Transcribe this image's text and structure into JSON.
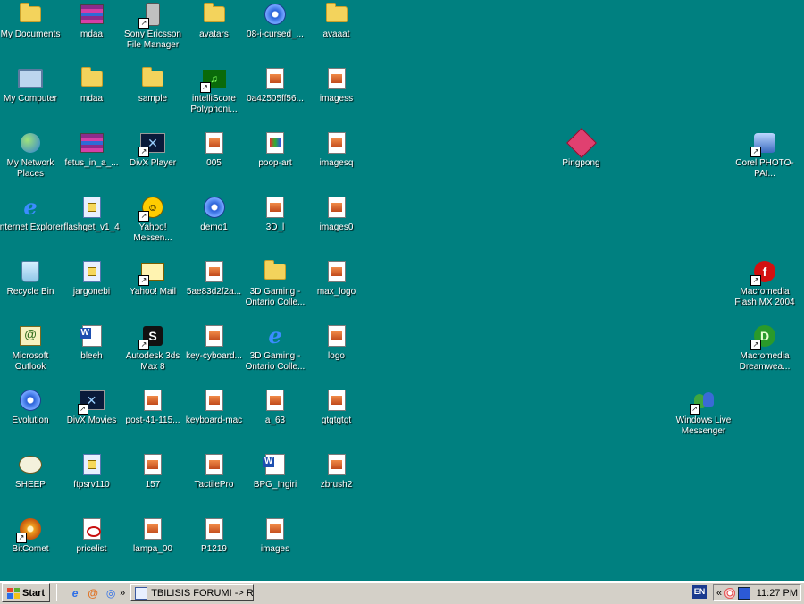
{
  "desktop": {
    "icons": [
      {
        "id": "my-documents",
        "label": "My Documents",
        "glyph": "g-folder",
        "col": 0,
        "row": 0,
        "shortcut": false
      },
      {
        "id": "my-computer",
        "label": "My Computer",
        "glyph": "g-pc",
        "col": 0,
        "row": 1,
        "shortcut": false
      },
      {
        "id": "my-network-places",
        "label": "My Network Places",
        "glyph": "g-globe",
        "col": 0,
        "row": 2,
        "shortcut": false
      },
      {
        "id": "internet-explorer",
        "label": "Internet Explorer",
        "glyph": "g-ie",
        "col": 0,
        "row": 3,
        "shortcut": false
      },
      {
        "id": "recycle-bin",
        "label": "Recycle Bin",
        "glyph": "g-bin",
        "col": 0,
        "row": 4,
        "shortcut": false
      },
      {
        "id": "microsoft-outlook",
        "label": "Microsoft Outlook",
        "glyph": "g-outlook",
        "col": 0,
        "row": 5,
        "shortcut": false
      },
      {
        "id": "evolution",
        "label": "Evolution",
        "glyph": "g-media",
        "col": 0,
        "row": 6,
        "shortcut": false
      },
      {
        "id": "sheep",
        "label": "SHEEP",
        "glyph": "g-sheep",
        "col": 0,
        "row": 7,
        "shortcut": false
      },
      {
        "id": "bitcomet",
        "label": "BitComet",
        "glyph": "g-bitcomet",
        "col": 0,
        "row": 8,
        "shortcut": true
      },
      {
        "id": "mdaa-rar",
        "label": "mdaa",
        "glyph": "g-rar",
        "col": 1,
        "row": 0,
        "shortcut": false
      },
      {
        "id": "mdaa-folder",
        "label": "mdaa",
        "glyph": "g-folder",
        "col": 1,
        "row": 1,
        "shortcut": false
      },
      {
        "id": "fetus",
        "label": "fetus_in_a_...",
        "glyph": "g-rar",
        "col": 1,
        "row": 2,
        "shortcut": false
      },
      {
        "id": "flashget",
        "label": "flashget_v1_4",
        "glyph": "g-exe",
        "col": 1,
        "row": 3,
        "shortcut": false
      },
      {
        "id": "jargonebi",
        "label": "jargonebi",
        "glyph": "g-exe",
        "col": 1,
        "row": 4,
        "shortcut": false
      },
      {
        "id": "bleeh",
        "label": "bleeh",
        "glyph": "g-word",
        "col": 1,
        "row": 5,
        "shortcut": false
      },
      {
        "id": "divx-movies",
        "label": "DivX Movies",
        "glyph": "g-divx",
        "col": 1,
        "row": 6,
        "shortcut": true
      },
      {
        "id": "ftpsrv110",
        "label": "ftpsrv110",
        "glyph": "g-exe",
        "col": 1,
        "row": 7,
        "shortcut": false
      },
      {
        "id": "pricelist",
        "label": "pricelist",
        "glyph": "g-pdf",
        "col": 1,
        "row": 8,
        "shortcut": false
      },
      {
        "id": "sony-ericsson",
        "label": "Sony Ericsson File Manager",
        "glyph": "g-ericsson",
        "col": 2,
        "row": 0,
        "shortcut": true
      },
      {
        "id": "sample",
        "label": "sample",
        "glyph": "g-folder",
        "col": 2,
        "row": 1,
        "shortcut": false
      },
      {
        "id": "divx-player",
        "label": "DivX Player",
        "glyph": "g-divx",
        "col": 2,
        "row": 2,
        "shortcut": true
      },
      {
        "id": "yahoo-messenger",
        "label": "Yahoo! Messen...",
        "glyph": "g-yahoo",
        "col": 2,
        "row": 3,
        "shortcut": true
      },
      {
        "id": "yahoo-mail",
        "label": "Yahoo! Mail",
        "glyph": "g-ymail",
        "col": 2,
        "row": 4,
        "shortcut": true
      },
      {
        "id": "autodesk-3ds",
        "label": "Autodesk 3ds Max 8",
        "glyph": "g-3ds",
        "col": 2,
        "row": 5,
        "shortcut": true
      },
      {
        "id": "post-41",
        "label": "post-41-115...",
        "glyph": "g-img",
        "col": 2,
        "row": 6,
        "shortcut": false
      },
      {
        "id": "img-157",
        "label": "157",
        "glyph": "g-img",
        "col": 2,
        "row": 7,
        "shortcut": false
      },
      {
        "id": "lampa",
        "label": "lampa_00",
        "glyph": "g-img",
        "col": 2,
        "row": 8,
        "shortcut": false
      },
      {
        "id": "avatars",
        "label": "avatars",
        "glyph": "g-folder",
        "col": 3,
        "row": 0,
        "shortcut": false
      },
      {
        "id": "intelliscore",
        "label": "intelliScore Polyphoni...",
        "glyph": "g-intelli",
        "col": 3,
        "row": 1,
        "shortcut": true
      },
      {
        "id": "img-005",
        "label": "005",
        "glyph": "g-img",
        "col": 3,
        "row": 2,
        "shortcut": false
      },
      {
        "id": "demo1",
        "label": "demo1",
        "glyph": "g-media",
        "col": 3,
        "row": 3,
        "shortcut": false
      },
      {
        "id": "img-5ae83",
        "label": "5ae83d2f2a...",
        "glyph": "g-img",
        "col": 3,
        "row": 4,
        "shortcut": false
      },
      {
        "id": "key-cyboard",
        "label": "key-cyboard...",
        "glyph": "g-img",
        "col": 3,
        "row": 5,
        "shortcut": false
      },
      {
        "id": "keyboard-mac",
        "label": "keyboard-mac",
        "glyph": "g-img",
        "col": 3,
        "row": 6,
        "shortcut": false
      },
      {
        "id": "tactilepro",
        "label": "TactilePro",
        "glyph": "g-img",
        "col": 3,
        "row": 7,
        "shortcut": false
      },
      {
        "id": "p1219",
        "label": "P1219",
        "glyph": "g-img",
        "col": 3,
        "row": 8,
        "shortcut": false
      },
      {
        "id": "cursed",
        "label": "08-i-cursed_...",
        "glyph": "g-media",
        "col": 4,
        "row": 0,
        "shortcut": false
      },
      {
        "id": "img-0a425",
        "label": "0a42505ff56...",
        "glyph": "g-img",
        "col": 4,
        "row": 1,
        "shortcut": false
      },
      {
        "id": "poop-art",
        "label": "poop-art",
        "glyph": "g-poop",
        "col": 4,
        "row": 2,
        "shortcut": false
      },
      {
        "id": "img-3d-l",
        "label": "3D_l",
        "glyph": "g-img",
        "col": 4,
        "row": 3,
        "shortcut": false
      },
      {
        "id": "gaming-folder",
        "label": "3D Gaming - Ontario Colle...",
        "glyph": "g-folder",
        "col": 4,
        "row": 4,
        "shortcut": false
      },
      {
        "id": "gaming-ie",
        "label": "3D Gaming - Ontario Colle...",
        "glyph": "g-ie",
        "col": 4,
        "row": 5,
        "shortcut": false
      },
      {
        "id": "a63",
        "label": "a_63",
        "glyph": "g-img",
        "col": 4,
        "row": 6,
        "shortcut": false
      },
      {
        "id": "bpg-ingiri",
        "label": "BPG_Ingiri",
        "glyph": "g-word",
        "col": 4,
        "row": 7,
        "shortcut": false
      },
      {
        "id": "images",
        "label": "images",
        "glyph": "g-img",
        "col": 4,
        "row": 8,
        "shortcut": false
      },
      {
        "id": "avaaat",
        "label": "avaaat",
        "glyph": "g-folder",
        "col": 5,
        "row": 0,
        "shortcut": false
      },
      {
        "id": "imagess",
        "label": "imagess",
        "glyph": "g-img",
        "col": 5,
        "row": 1,
        "shortcut": false
      },
      {
        "id": "imagesq",
        "label": "imagesq",
        "glyph": "g-img",
        "col": 5,
        "row": 2,
        "shortcut": false
      },
      {
        "id": "images0",
        "label": "images0",
        "glyph": "g-img",
        "col": 5,
        "row": 3,
        "shortcut": false
      },
      {
        "id": "max-logo",
        "label": "max_logo",
        "glyph": "g-img",
        "col": 5,
        "row": 4,
        "shortcut": false
      },
      {
        "id": "logo",
        "label": "logo",
        "glyph": "g-img",
        "col": 5,
        "row": 5,
        "shortcut": false
      },
      {
        "id": "gtgtgtgt",
        "label": "gtgtgtgt",
        "glyph": "g-img",
        "col": 5,
        "row": 6,
        "shortcut": false
      },
      {
        "id": "zbrush2",
        "label": "zbrush2",
        "glyph": "g-img",
        "col": 5,
        "row": 7,
        "shortcut": false
      },
      {
        "id": "pingpong",
        "label": "Pingpong",
        "glyph": "g-pingpong",
        "col": 9,
        "row": 2,
        "shortcut": false
      },
      {
        "id": "windows-live-messenger",
        "label": "Windows Live Messenger",
        "glyph": "g-msn",
        "col": 11,
        "row": 6,
        "shortcut": true
      },
      {
        "id": "corel",
        "label": "Corel PHOTO-PAI...",
        "glyph": "g-corel",
        "col": 12,
        "row": 2,
        "shortcut": true
      },
      {
        "id": "macromedia-flash",
        "label": "Macromedia Flash MX 2004",
        "glyph": "g-flash",
        "col": 12,
        "row": 4,
        "shortcut": true
      },
      {
        "id": "macromedia-dreamweaver",
        "label": "Macromedia Dreamwea...",
        "glyph": "g-dream",
        "col": 12,
        "row": 5,
        "shortcut": true
      }
    ]
  },
  "taskbar": {
    "start_label": "Start",
    "overflow_chevron": "»",
    "task_button_label": "TBILISIS FORUMI -> Re...",
    "language": "EN",
    "tray_chevron": "«",
    "clock": "11:27 PM"
  },
  "colors": {
    "desktop_bg": "#008080",
    "taskbar_bg": "#d4d0c8"
  }
}
